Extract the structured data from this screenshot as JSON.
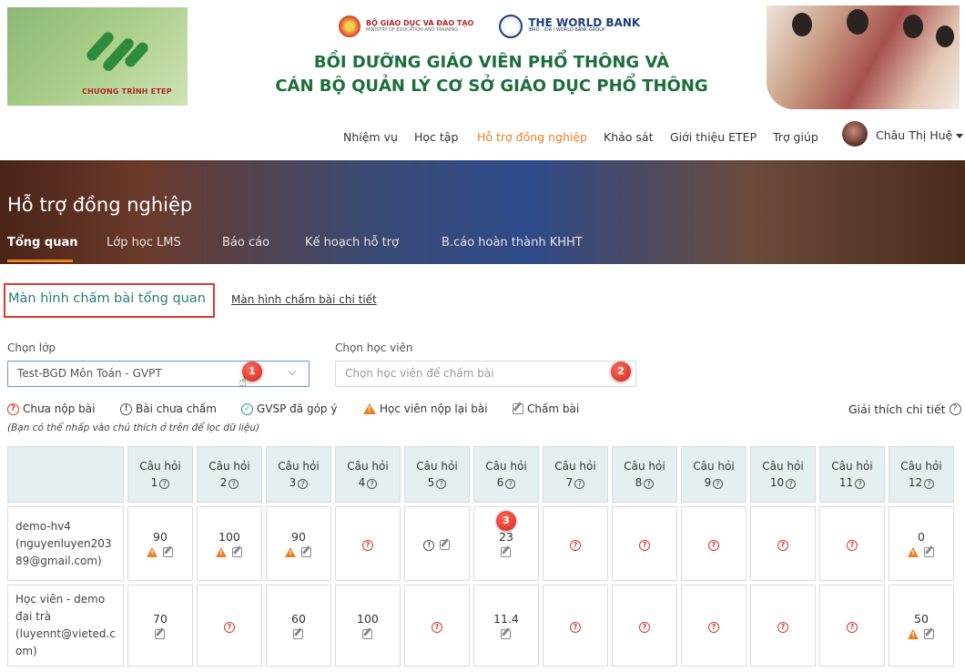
{
  "header": {
    "logo_text": "CHƯƠNG TRÌNH ETEP",
    "org1_main": "BỘ GIÁO DỤC VÀ ĐÀO TẠO",
    "org1_sub": "MINISTRY OF EDUCATION AND TRAINING",
    "org2_main": "THE WORLD BANK",
    "org2_sub": "IBRD · IDA | WORLD BANK GROUP",
    "title_line1": "BỒI DƯỠNG GIÁO VIÊN PHỔ THÔNG VÀ",
    "title_line2": "CÁN BỘ QUẢN LÝ CƠ SỞ GIÁO DỤC PHỔ THÔNG"
  },
  "nav": {
    "items": [
      "Nhiệm vụ",
      "Học tập",
      "Hỗ trợ đồng nghiệp",
      "Khảo sát",
      "Giới thiệu ETEP",
      "Trợ giúp"
    ],
    "active_index": 2,
    "user_name": "Châu Thị Huệ"
  },
  "banner": {
    "title": "Hỗ trợ đồng nghiệp",
    "tabs": [
      "Tổng quan",
      "Lớp học LMS",
      "Báo cáo",
      "Kế hoạch hỗ trợ",
      "B.cáo hoàn thành KHHT"
    ]
  },
  "subtabs": {
    "active": "Màn hình chấm bài tổng quan",
    "other": "Màn hình chấm bài chi tiết"
  },
  "filters": {
    "class_label": "Chọn lớp",
    "class_value": "Test-BGD Môn Toán - GVPT",
    "student_label": "Chọn học viên",
    "student_placeholder": "Chọn học viên để chấm bài"
  },
  "badges": [
    "1",
    "2",
    "3"
  ],
  "legend": {
    "items": [
      "Chưa nộp bài",
      "Bài chưa chấm",
      "GVSP đã góp ý",
      "Học viên nộp lại bài",
      "Chấm bài"
    ],
    "note": "(Bạn có thể nhấp vào chú thích ở trên để lọc dữ liệu)",
    "explain": "Giải thích chi tiết"
  },
  "table": {
    "q_label": "Câu hỏi",
    "questions": [
      "1",
      "2",
      "3",
      "4",
      "5",
      "6",
      "7",
      "8",
      "9",
      "10",
      "11",
      "12"
    ],
    "rows": [
      {
        "name_lines": [
          "demo-hv4",
          "(nguyenluyen203",
          "89@gmail.com)"
        ],
        "cells": [
          {
            "score": "90",
            "icons": [
              "warn",
              "edit"
            ]
          },
          {
            "score": "100",
            "icons": [
              "warn",
              "edit"
            ]
          },
          {
            "score": "90",
            "icons": [
              "warn",
              "edit"
            ]
          },
          {
            "score": "",
            "icons": [
              "missing"
            ]
          },
          {
            "score": "",
            "icons": [
              "pending",
              "edit"
            ]
          },
          {
            "score": "23",
            "icons": [
              "edit"
            ]
          },
          {
            "score": "",
            "icons": [
              "missing"
            ]
          },
          {
            "score": "",
            "icons": [
              "missing"
            ]
          },
          {
            "score": "",
            "icons": [
              "missing"
            ]
          },
          {
            "score": "",
            "icons": [
              "missing"
            ]
          },
          {
            "score": "",
            "icons": [
              "missing"
            ]
          },
          {
            "score": "0",
            "icons": [
              "warn",
              "edit"
            ]
          }
        ]
      },
      {
        "name_lines": [
          "Học viên - demo",
          "đại trà",
          "(luyennt@vieted.c",
          "om)"
        ],
        "cells": [
          {
            "score": "70",
            "icons": [
              "edit"
            ]
          },
          {
            "score": "",
            "icons": [
              "missing"
            ]
          },
          {
            "score": "60",
            "icons": [
              "edit"
            ]
          },
          {
            "score": "100",
            "icons": [
              "edit"
            ]
          },
          {
            "score": "",
            "icons": [
              "missing"
            ]
          },
          {
            "score": "11.4",
            "icons": [
              "edit"
            ]
          },
          {
            "score": "",
            "icons": [
              "missing"
            ]
          },
          {
            "score": "",
            "icons": [
              "missing"
            ]
          },
          {
            "score": "",
            "icons": [
              "missing"
            ]
          },
          {
            "score": "",
            "icons": [
              "missing"
            ]
          },
          {
            "score": "",
            "icons": [
              "missing"
            ]
          },
          {
            "score": "50",
            "icons": [
              "warn",
              "edit"
            ]
          }
        ]
      }
    ]
  },
  "colors": {
    "accent_orange": "#ef7d22",
    "title_green": "#1c6f3a",
    "teal_text": "#2a7b7a",
    "badge_red": "#d8231a",
    "header_cell_bg": "#e3eff0"
  }
}
